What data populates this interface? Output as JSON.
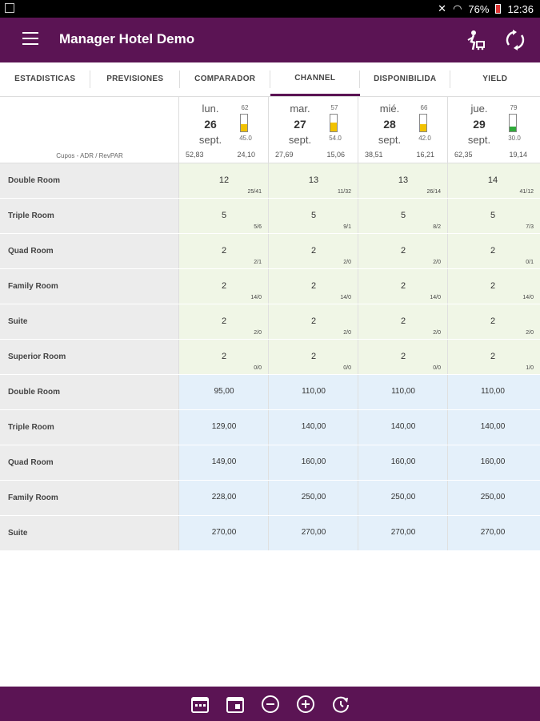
{
  "status": {
    "battery": "76%",
    "time": "12:36"
  },
  "app": {
    "title": "Manager Hotel Demo"
  },
  "tabs": [
    {
      "label": "ESTADISTICAS"
    },
    {
      "label": "PREVISIONES"
    },
    {
      "label": "COMPARADOR"
    },
    {
      "label": "CHANNEL"
    },
    {
      "label": "DISPONIBILIDA"
    },
    {
      "label": "YIELD"
    }
  ],
  "header": {
    "legend": "Cupos - ADR / RevPAR",
    "days": [
      {
        "dname": "lun.",
        "dnum": "26",
        "dmon": "sept.",
        "occ": "62",
        "occ2": "45.0",
        "adr": "52,83",
        "revpar": "24,10",
        "fill_pct": 45,
        "fill_color": "#f2c200"
      },
      {
        "dname": "mar.",
        "dnum": "27",
        "dmon": "sept.",
        "occ": "57",
        "occ2": "54.0",
        "adr": "27,69",
        "revpar": "15,06",
        "fill_pct": 54,
        "fill_color": "#f2c200"
      },
      {
        "dname": "mié.",
        "dnum": "28",
        "dmon": "sept.",
        "occ": "66",
        "occ2": "42.0",
        "adr": "38,51",
        "revpar": "16,21",
        "fill_pct": 42,
        "fill_color": "#f2c200"
      },
      {
        "dname": "jue.",
        "dnum": "29",
        "dmon": "sept.",
        "occ": "79",
        "occ2": "30.0",
        "adr": "62,35",
        "revpar": "19,14",
        "fill_pct": 30,
        "fill_color": "#2faa3a"
      }
    ]
  },
  "quota_rows": [
    {
      "name": "Double Room",
      "cells": [
        {
          "v": "12",
          "s": "25/41"
        },
        {
          "v": "13",
          "s": "11/32"
        },
        {
          "v": "13",
          "s": "26/14"
        },
        {
          "v": "14",
          "s": "41/12"
        }
      ]
    },
    {
      "name": "Triple Room",
      "cells": [
        {
          "v": "5",
          "s": "5/6"
        },
        {
          "v": "5",
          "s": "9/1"
        },
        {
          "v": "5",
          "s": "8/2"
        },
        {
          "v": "5",
          "s": "7/3"
        }
      ]
    },
    {
      "name": "Quad Room",
      "cells": [
        {
          "v": "2",
          "s": "2/1"
        },
        {
          "v": "2",
          "s": "2/0"
        },
        {
          "v": "2",
          "s": "2/0"
        },
        {
          "v": "2",
          "s": "0/1"
        }
      ]
    },
    {
      "name": "Family Room",
      "cells": [
        {
          "v": "2",
          "s": "14/0"
        },
        {
          "v": "2",
          "s": "14/0"
        },
        {
          "v": "2",
          "s": "14/0"
        },
        {
          "v": "2",
          "s": "14/0"
        }
      ]
    },
    {
      "name": "Suite",
      "cells": [
        {
          "v": "2",
          "s": "2/0"
        },
        {
          "v": "2",
          "s": "2/0"
        },
        {
          "v": "2",
          "s": "2/0"
        },
        {
          "v": "2",
          "s": "2/0"
        }
      ]
    },
    {
      "name": "Superior Room",
      "cells": [
        {
          "v": "2",
          "s": "0/0"
        },
        {
          "v": "2",
          "s": "0/0"
        },
        {
          "v": "2",
          "s": "0/0"
        },
        {
          "v": "2",
          "s": "1/0"
        }
      ]
    }
  ],
  "price_rows": [
    {
      "name": "Double Room",
      "cells": [
        "95,00",
        "110,00",
        "110,00",
        "110,00"
      ]
    },
    {
      "name": "Triple Room",
      "cells": [
        "129,00",
        "140,00",
        "140,00",
        "140,00"
      ]
    },
    {
      "name": "Quad Room",
      "cells": [
        "149,00",
        "160,00",
        "160,00",
        "160,00"
      ]
    },
    {
      "name": "Family Room",
      "cells": [
        "228,00",
        "250,00",
        "250,00",
        "250,00"
      ]
    },
    {
      "name": "Suite",
      "cells": [
        "270,00",
        "270,00",
        "270,00",
        "270,00"
      ]
    }
  ],
  "bottom_icons": [
    "calendar-range-icon",
    "calendar-icon",
    "zoom-out-icon",
    "zoom-in-icon",
    "refresh-icon"
  ]
}
